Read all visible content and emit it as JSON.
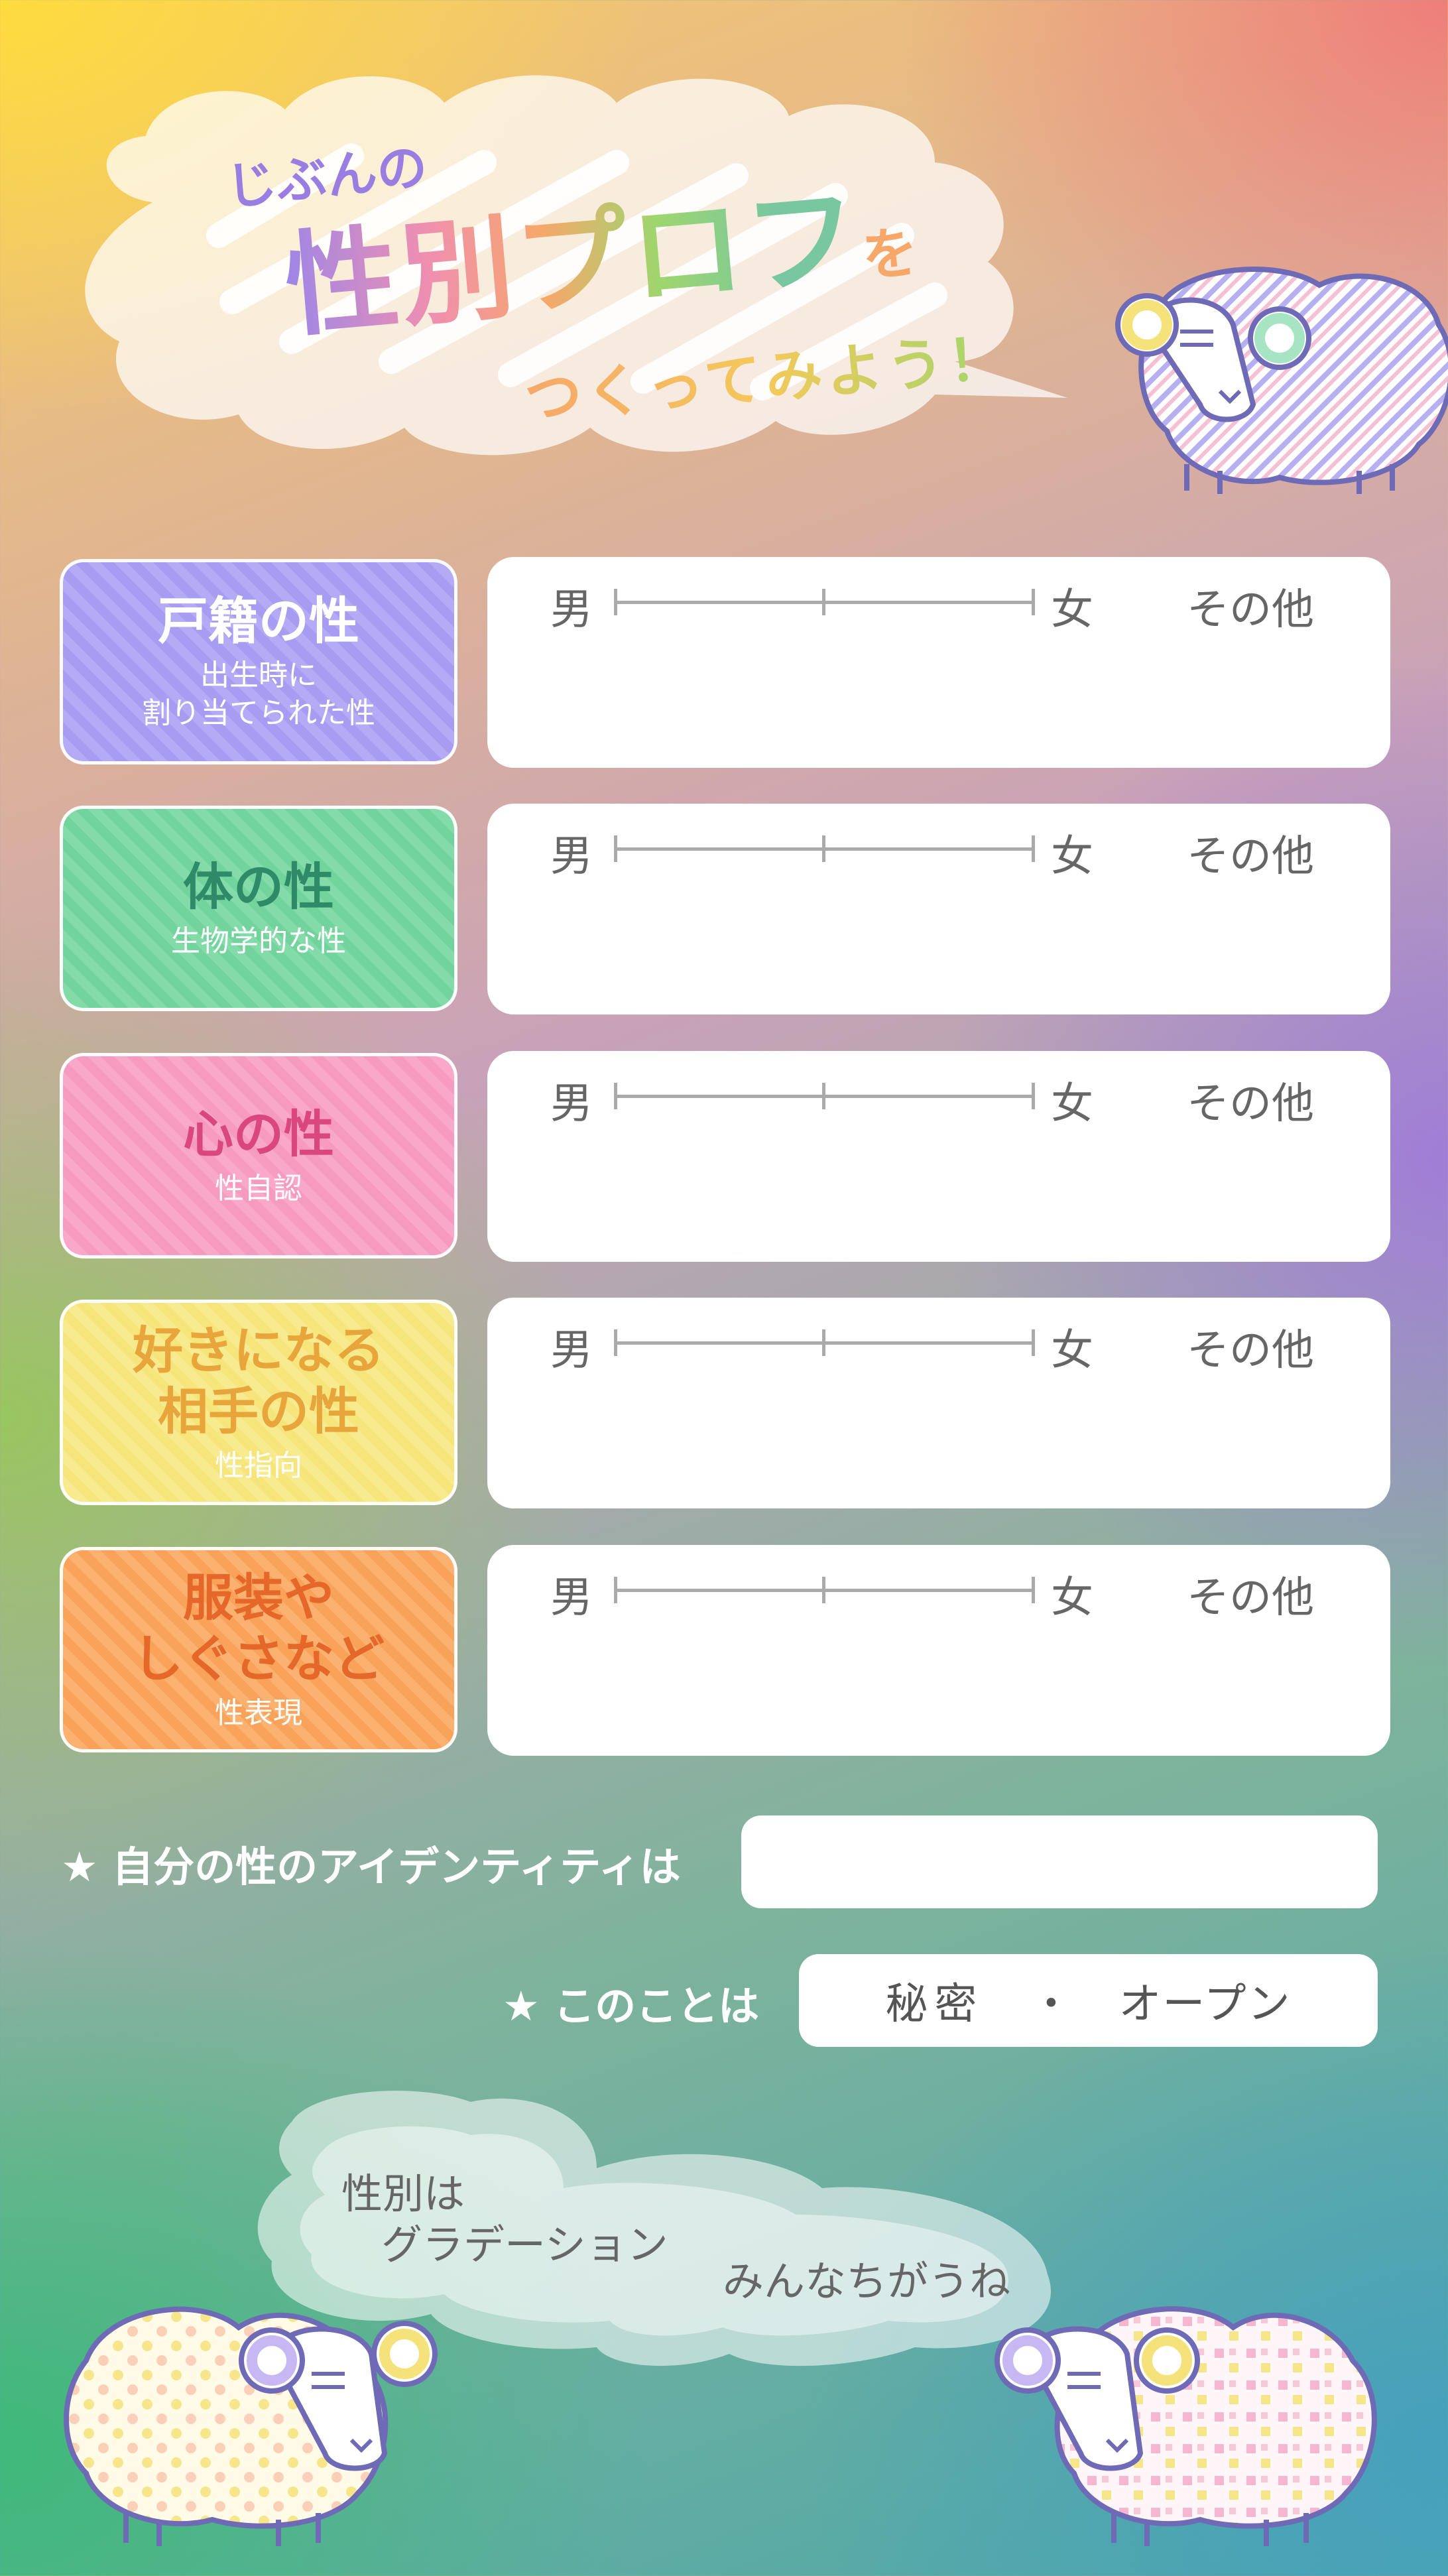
{
  "title": {
    "line1": "じぶんの",
    "line2": "性別プロフを",
    "line2_main": "性別プロフ",
    "line2_particle": "を",
    "line3": "つくってみよう！"
  },
  "scale": {
    "left": "男",
    "right": "女",
    "other": "その他"
  },
  "rows": [
    {
      "title": "戸籍の性",
      "subtitle": "出生時に\n割り当てられた性",
      "color": "#a79cf2"
    },
    {
      "title": "体の性",
      "subtitle": "生物学的な性",
      "color": "#73d39c"
    },
    {
      "title": "心の性",
      "subtitle": "性自認",
      "color": "#f79ac0"
    },
    {
      "title": "好きになる\n相手の性",
      "subtitle": "性指向",
      "color": "#f6e57a"
    },
    {
      "title": "服装や\nしぐさなど",
      "subtitle": "性表現",
      "color": "#f9a35a"
    }
  ],
  "identity": {
    "label": "★ 自分の性のアイデンティティは"
  },
  "disclosure": {
    "label": "★ このことは",
    "option_secret": "秘密",
    "separator": "・",
    "option_open": "オープン"
  },
  "bubble": {
    "line1": "性別は",
    "line2": "グラデーション",
    "line3": "みんなちがうね"
  },
  "icons": [
    "sheep-striped-icon",
    "sheep-dotted-icon",
    "sheep-checkered-icon"
  ]
}
